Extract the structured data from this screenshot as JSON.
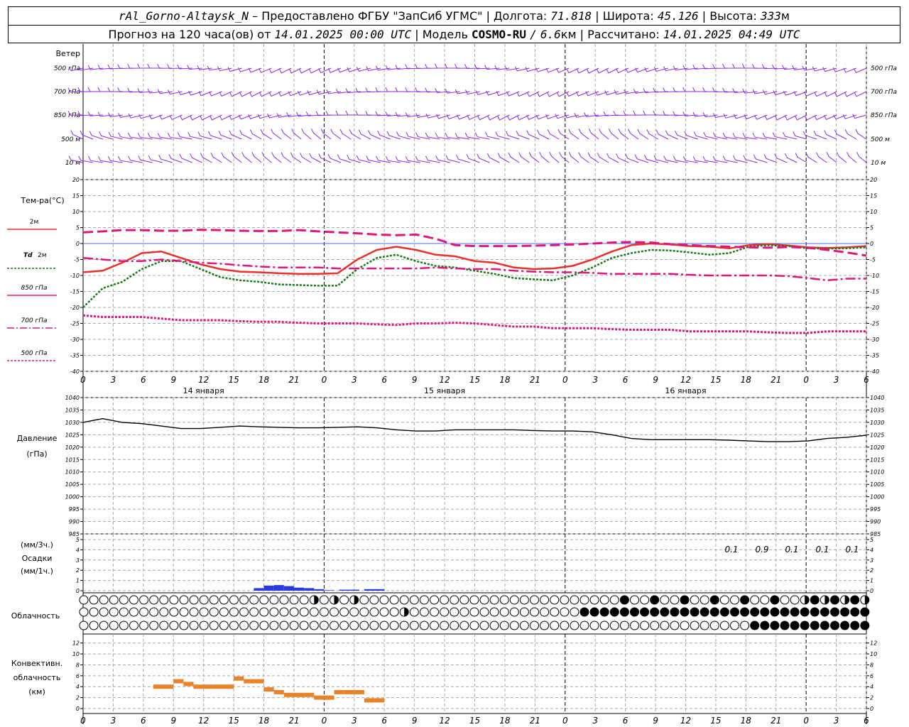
{
  "header": {
    "station": "rAl_Gorno-Altaysk_N",
    "dash": "–",
    "provided": "Предоставлено ФГБУ \"ЗапСиб УГМС\"",
    "lon_label": "Долгота:",
    "lon": "71.818",
    "lat_label": "Широта:",
    "lat": "45.126",
    "alt_label": "Высота:",
    "alt": "333",
    "alt_unit": "м",
    "forecast_label": "Прогноз на 120 часа(ов) от",
    "forecast_from": "14.01.2025 00:00 UTC",
    "model_label": "Модель",
    "model": "COSMO-RU",
    "res_sep": "/",
    "res": "6.6",
    "res_unit": "км",
    "calc_label": "Рассчитано:",
    "calc_time": "14.01.2025 04:49 UTC",
    "sep": "|"
  },
  "labels": {
    "wind": "Ветер",
    "levels": [
      "500 гПа",
      "700 гПа",
      "850 гПа",
      "500 м",
      "10 м"
    ],
    "temp": "Тем-ра(°С)",
    "leg_2m": "2м",
    "leg_td": "Td",
    "leg_td2": "2м",
    "leg_850": "850 гПа",
    "leg_700": "700 гПа",
    "leg_500": "500 гПа",
    "pressure": "Давление",
    "pressure_unit": "(гПа)",
    "precip_unit3": "(мм/3ч.)",
    "precip": "Осадки",
    "precip_unit1": "(мм/1ч.)",
    "cloud": "Облачность",
    "conv1": "Конвективн.",
    "conv2": "облачность",
    "conv3": "(км)",
    "days": [
      "14 января",
      "15 января",
      "16 января"
    ]
  },
  "colors": {
    "wind": "#8a2be2",
    "t2m": "#e8312a",
    "td2m": "#1a7a1a",
    "t850": "#e0177a",
    "t700": "#e0177a",
    "t500": "#e0177a",
    "zero": "#4d6bff",
    "precip": "#2a3bdc",
    "conv": "#e8832a"
  },
  "chart_data": [
    {
      "type": "line",
      "title": "Тем-ра(°С)",
      "ylim": [
        -40,
        20
      ],
      "x_ticks": [
        "0",
        "3",
        "6",
        "9",
        "12",
        "15",
        "18",
        "21",
        "0",
        "3",
        "6",
        "9",
        "12",
        "15",
        "18",
        "21",
        "0",
        "3",
        "6",
        "9",
        "12",
        "15",
        "18",
        "21",
        "0",
        "3",
        "6"
      ],
      "y_ticks": [
        20,
        15,
        10,
        5,
        0,
        -5,
        -10,
        -15,
        -20,
        -25,
        -30,
        -35,
        -40
      ],
      "x_hours": [
        0,
        3,
        6,
        9,
        12,
        15,
        18,
        21,
        24,
        27,
        30,
        33,
        36,
        39,
        42,
        45,
        48,
        51,
        54,
        57,
        60,
        63,
        66,
        69,
        72,
        75,
        78
      ],
      "series": [
        {
          "name": "2м",
          "values": [
            -9,
            -8.5,
            -6,
            -3,
            -2.5,
            -4.5,
            -6.5,
            -8,
            -8.8,
            -9,
            -9.3,
            -9.5,
            -9.5,
            -9.3,
            -5,
            -2,
            -1,
            -2,
            -3.5,
            -4,
            -5.5,
            -6,
            -7.5,
            -8,
            -7.8,
            -7,
            -5,
            -2.5,
            -0.5,
            0,
            -0.3,
            -0.8,
            -1,
            -1.5,
            -0.5,
            -0.2,
            -0.6,
            -1.2,
            -1.4,
            -1.2,
            -0.8
          ]
        },
        {
          "name": "Td 2м",
          "values": [
            -20,
            -14,
            -12,
            -8,
            -5.5,
            -5.5,
            -8,
            -10.5,
            -11.5,
            -12,
            -12.8,
            -13,
            -13.2,
            -13.2,
            -8,
            -4.5,
            -3.5,
            -5.5,
            -7,
            -7.5,
            -8.5,
            -9.5,
            -10.8,
            -11.2,
            -11.5,
            -10,
            -7.5,
            -4.5,
            -3,
            -2,
            -2.2,
            -2.8,
            -3.5,
            -3,
            -1,
            -0.5,
            -0.8,
            -1.5,
            -1.6,
            -1.5,
            -1.2
          ]
        },
        {
          "name": "850 гПа",
          "values": [
            3.5,
            3.8,
            4.2,
            4.2,
            4,
            4,
            4.3,
            4.2,
            4,
            3.9,
            3.9,
            4.2,
            3.8,
            3.5,
            3.2,
            2.8,
            2.6,
            2.8,
            1.5,
            -0.5,
            -0.8,
            -0.8,
            -0.8,
            -0.7,
            -0.5,
            -0.3,
            0,
            0.3,
            0.5,
            0.3,
            -0.2,
            -0.5,
            -0.8,
            -1,
            -1.2,
            -1.3,
            -1.1,
            -1.3,
            -2,
            -2.8,
            -3.8
          ]
        },
        {
          "name": "700 гПа",
          "values": [
            -4.5,
            -5,
            -5.5,
            -5.5,
            -5,
            -5.5,
            -6,
            -6.3,
            -6.8,
            -7.2,
            -7.5,
            -7.5,
            -7.5,
            -7.8,
            -7.8,
            -7.8,
            -7.8,
            -7.8,
            -7.5,
            -7.8,
            -8,
            -8,
            -8.5,
            -8.8,
            -9,
            -9,
            -9.2,
            -9.5,
            -9.5,
            -9.5,
            -9.5,
            -9.8,
            -10,
            -10,
            -10,
            -10,
            -10.2,
            -10.8,
            -11.5,
            -11,
            -11
          ]
        },
        {
          "name": "500 гПа",
          "values": [
            -22.5,
            -23,
            -23,
            -23,
            -23.5,
            -24,
            -24,
            -24,
            -24.3,
            -24.5,
            -24.5,
            -24.8,
            -25,
            -25,
            -25,
            -25.3,
            -25.5,
            -25,
            -25,
            -24.8,
            -25,
            -25.5,
            -26,
            -26,
            -26.5,
            -26.5,
            -26.5,
            -26.8,
            -27,
            -27,
            -27,
            -27.5,
            -27.5,
            -27.5,
            -27.5,
            -27.8,
            -28,
            -28,
            -27.5,
            -27.5,
            -27.5
          ]
        }
      ]
    },
    {
      "type": "line",
      "title": "Давление",
      "ylabel": "(гПа)",
      "ylim": [
        985,
        1040
      ],
      "y_ticks": [
        1040,
        1035,
        1030,
        1025,
        1020,
        1015,
        1010,
        1005,
        1000,
        995,
        990,
        985
      ],
      "series": [
        {
          "name": "Давление",
          "values": [
            1030,
            1031.5,
            1030,
            1029.5,
            1028.5,
            1027.5,
            1027.5,
            1028,
            1028.5,
            1028.2,
            1028,
            1027.8,
            1027.8,
            1028,
            1028.2,
            1027.8,
            1027,
            1026.5,
            1026.5,
            1027,
            1027,
            1027,
            1027,
            1026.7,
            1026.5,
            1026.5,
            1026.2,
            1025,
            1023.5,
            1023,
            1023,
            1023,
            1023,
            1022.8,
            1022.5,
            1022.2,
            1022.2,
            1022.5,
            1023.5,
            1024,
            1024.8
          ]
        }
      ]
    },
    {
      "type": "bar",
      "title": "Осадки",
      "ylabel": "(мм/3ч.) (мм/1ч.)",
      "ylim": [
        0,
        5
      ],
      "y_ticks": [
        5,
        4,
        3,
        2,
        1,
        0
      ],
      "data_labels": [
        "0.1",
        "0.9",
        "0.1",
        "0.1",
        "0.1"
      ],
      "bars": [
        {
          "h": 17.5,
          "v": 0.25
        },
        {
          "h": 18.5,
          "v": 0.5
        },
        {
          "h": 19.5,
          "v": 0.55
        },
        {
          "h": 20.5,
          "v": 0.45
        },
        {
          "h": 21.5,
          "v": 0.3
        },
        {
          "h": 22.5,
          "v": 0.25
        },
        {
          "h": 23.5,
          "v": 0.15
        },
        {
          "h": 24.5,
          "v": 0.05
        },
        {
          "h": 26,
          "v": 0.1
        },
        {
          "h": 27,
          "v": 0.1
        },
        {
          "h": 28.5,
          "v": 0.15
        },
        {
          "h": 29.5,
          "v": 0.15
        }
      ]
    },
    {
      "type": "bar",
      "title": "Конвективн. облачность",
      "ylabel": "(км)",
      "ylim": [
        0,
        13
      ],
      "y_ticks": [
        12,
        10,
        8,
        6,
        4,
        2,
        0
      ],
      "bars": [
        {
          "h": 7.5,
          "v": 4
        },
        {
          "h": 8.5,
          "v": 4
        },
        {
          "h": 9.5,
          "v": 5
        },
        {
          "h": 10.5,
          "v": 4.5
        },
        {
          "h": 11.5,
          "v": 4
        },
        {
          "h": 12.5,
          "v": 4
        },
        {
          "h": 13.5,
          "v": 4
        },
        {
          "h": 14.5,
          "v": 4
        },
        {
          "h": 15.5,
          "v": 5.5
        },
        {
          "h": 16.5,
          "v": 5
        },
        {
          "h": 17.5,
          "v": 5
        },
        {
          "h": 18.5,
          "v": 3.5
        },
        {
          "h": 19.5,
          "v": 3
        },
        {
          "h": 20.5,
          "v": 2.5
        },
        {
          "h": 21.5,
          "v": 2.5
        },
        {
          "h": 22.5,
          "v": 2.5
        },
        {
          "h": 23.5,
          "v": 2
        },
        {
          "h": 24.5,
          "v": 2
        },
        {
          "h": 25.5,
          "v": 3
        },
        {
          "h": 26.5,
          "v": 3
        },
        {
          "h": 27.5,
          "v": 3
        },
        {
          "h": 28.5,
          "v": 1.5
        },
        {
          "h": 29.5,
          "v": 1.5
        }
      ]
    }
  ]
}
